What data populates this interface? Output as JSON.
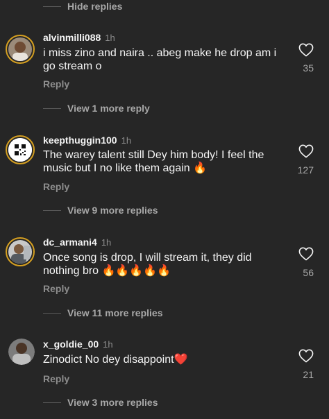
{
  "hide_replies_label": "Hide replies",
  "reply_label": "Reply",
  "comments": [
    {
      "username": "alvinmilli088",
      "time": "1h",
      "text": "i miss zino and naira .. abeg make he drop am i go stream o",
      "likes": "35",
      "more": "View 1 more reply"
    },
    {
      "username": "keepthuggin100",
      "time": "1h",
      "text": "The warey talent still Dey him body! I feel the music but I no like them again 🔥",
      "likes": "127",
      "more": "View 9 more replies"
    },
    {
      "username": "dc_armani4",
      "time": "1h",
      "text": "Once song is drop, I will stream it, they did nothing bro 🔥🔥🔥🔥🔥",
      "likes": "56",
      "more": "View 11 more replies"
    },
    {
      "username": "x_goldie_00",
      "time": "1h",
      "text": "Zinodict No dey disappoint❤️",
      "likes": "21",
      "more": "View 3 more replies"
    }
  ],
  "colors": {
    "background": "#262626",
    "text": "#f5f5f5",
    "muted": "#8e8e8e",
    "story_ring": "#d6a021"
  },
  "icons": {
    "like": "heart-outline-icon"
  }
}
